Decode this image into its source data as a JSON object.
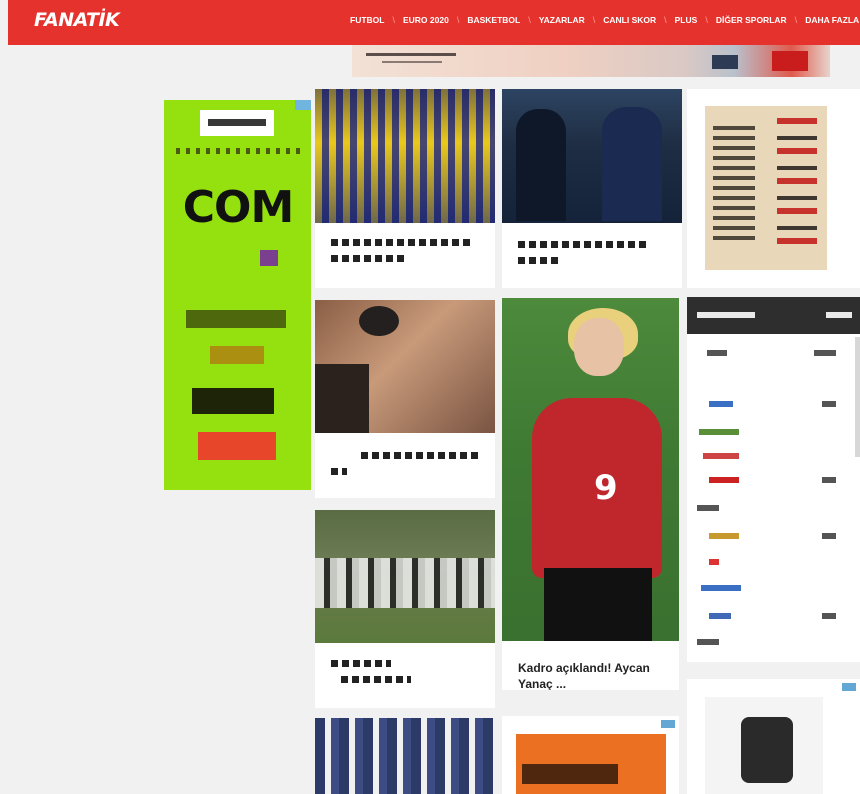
{
  "header": {
    "logo": "FANATİK",
    "nav": [
      "FUTBOL",
      "EURO 2020",
      "BASKETBOL",
      "YAZARLAR",
      "CANLI SKOR",
      "PLUS",
      "DİĞER SPORLAR",
      "DAHA FAZLA"
    ]
  },
  "colors": {
    "brand_red": "#e5322d",
    "page_bg": "#f1f1f1",
    "ad_lime": "#95e00f"
  },
  "ads": {
    "side_ad_text": "COM"
  },
  "cards": [
    {
      "id": "c1",
      "caption": ""
    },
    {
      "id": "c2",
      "caption": ""
    },
    {
      "id": "c3",
      "caption": ""
    },
    {
      "id": "c4",
      "caption": ""
    },
    {
      "id": "c5",
      "caption": "Kadro açıklandı! Aycan Yanaç ...",
      "jersey_number": "9"
    },
    {
      "id": "c6",
      "caption": ""
    },
    {
      "id": "c7",
      "caption": ""
    },
    {
      "id": "c8",
      "caption": ""
    },
    {
      "id": "c9",
      "caption": ""
    },
    {
      "id": "c10",
      "caption": ""
    }
  ]
}
